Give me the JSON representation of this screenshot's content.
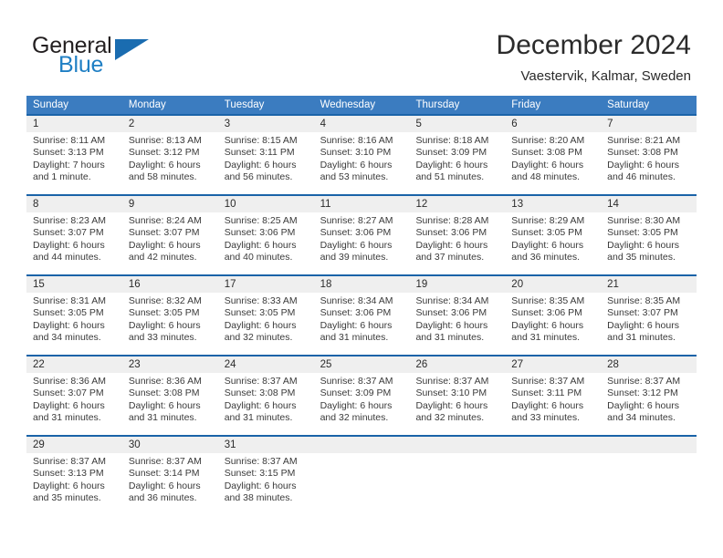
{
  "brand": {
    "word_one": "General",
    "word_two": "Blue",
    "triangle_color": "#1a6cb0",
    "blue_text_color": "#1f7fc4"
  },
  "header": {
    "title": "December 2024",
    "location": "Vaestervik, Kalmar, Sweden"
  },
  "theme": {
    "header_row_bg": "#3b7cc0",
    "week_divider": "#1a63a8",
    "date_band_bg": "#efefef"
  },
  "weekday_headers": [
    "Sunday",
    "Monday",
    "Tuesday",
    "Wednesday",
    "Thursday",
    "Friday",
    "Saturday"
  ],
  "weeks": [
    [
      {
        "day": "1",
        "sunrise": "Sunrise: 8:11 AM",
        "sunset": "Sunset: 3:13 PM",
        "daylight_1": "Daylight: 7 hours",
        "daylight_2": "and 1 minute."
      },
      {
        "day": "2",
        "sunrise": "Sunrise: 8:13 AM",
        "sunset": "Sunset: 3:12 PM",
        "daylight_1": "Daylight: 6 hours",
        "daylight_2": "and 58 minutes."
      },
      {
        "day": "3",
        "sunrise": "Sunrise: 8:15 AM",
        "sunset": "Sunset: 3:11 PM",
        "daylight_1": "Daylight: 6 hours",
        "daylight_2": "and 56 minutes."
      },
      {
        "day": "4",
        "sunrise": "Sunrise: 8:16 AM",
        "sunset": "Sunset: 3:10 PM",
        "daylight_1": "Daylight: 6 hours",
        "daylight_2": "and 53 minutes."
      },
      {
        "day": "5",
        "sunrise": "Sunrise: 8:18 AM",
        "sunset": "Sunset: 3:09 PM",
        "daylight_1": "Daylight: 6 hours",
        "daylight_2": "and 51 minutes."
      },
      {
        "day": "6",
        "sunrise": "Sunrise: 8:20 AM",
        "sunset": "Sunset: 3:08 PM",
        "daylight_1": "Daylight: 6 hours",
        "daylight_2": "and 48 minutes."
      },
      {
        "day": "7",
        "sunrise": "Sunrise: 8:21 AM",
        "sunset": "Sunset: 3:08 PM",
        "daylight_1": "Daylight: 6 hours",
        "daylight_2": "and 46 minutes."
      }
    ],
    [
      {
        "day": "8",
        "sunrise": "Sunrise: 8:23 AM",
        "sunset": "Sunset: 3:07 PM",
        "daylight_1": "Daylight: 6 hours",
        "daylight_2": "and 44 minutes."
      },
      {
        "day": "9",
        "sunrise": "Sunrise: 8:24 AM",
        "sunset": "Sunset: 3:07 PM",
        "daylight_1": "Daylight: 6 hours",
        "daylight_2": "and 42 minutes."
      },
      {
        "day": "10",
        "sunrise": "Sunrise: 8:25 AM",
        "sunset": "Sunset: 3:06 PM",
        "daylight_1": "Daylight: 6 hours",
        "daylight_2": "and 40 minutes."
      },
      {
        "day": "11",
        "sunrise": "Sunrise: 8:27 AM",
        "sunset": "Sunset: 3:06 PM",
        "daylight_1": "Daylight: 6 hours",
        "daylight_2": "and 39 minutes."
      },
      {
        "day": "12",
        "sunrise": "Sunrise: 8:28 AM",
        "sunset": "Sunset: 3:06 PM",
        "daylight_1": "Daylight: 6 hours",
        "daylight_2": "and 37 minutes."
      },
      {
        "day": "13",
        "sunrise": "Sunrise: 8:29 AM",
        "sunset": "Sunset: 3:05 PM",
        "daylight_1": "Daylight: 6 hours",
        "daylight_2": "and 36 minutes."
      },
      {
        "day": "14",
        "sunrise": "Sunrise: 8:30 AM",
        "sunset": "Sunset: 3:05 PM",
        "daylight_1": "Daylight: 6 hours",
        "daylight_2": "and 35 minutes."
      }
    ],
    [
      {
        "day": "15",
        "sunrise": "Sunrise: 8:31 AM",
        "sunset": "Sunset: 3:05 PM",
        "daylight_1": "Daylight: 6 hours",
        "daylight_2": "and 34 minutes."
      },
      {
        "day": "16",
        "sunrise": "Sunrise: 8:32 AM",
        "sunset": "Sunset: 3:05 PM",
        "daylight_1": "Daylight: 6 hours",
        "daylight_2": "and 33 minutes."
      },
      {
        "day": "17",
        "sunrise": "Sunrise: 8:33 AM",
        "sunset": "Sunset: 3:05 PM",
        "daylight_1": "Daylight: 6 hours",
        "daylight_2": "and 32 minutes."
      },
      {
        "day": "18",
        "sunrise": "Sunrise: 8:34 AM",
        "sunset": "Sunset: 3:06 PM",
        "daylight_1": "Daylight: 6 hours",
        "daylight_2": "and 31 minutes."
      },
      {
        "day": "19",
        "sunrise": "Sunrise: 8:34 AM",
        "sunset": "Sunset: 3:06 PM",
        "daylight_1": "Daylight: 6 hours",
        "daylight_2": "and 31 minutes."
      },
      {
        "day": "20",
        "sunrise": "Sunrise: 8:35 AM",
        "sunset": "Sunset: 3:06 PM",
        "daylight_1": "Daylight: 6 hours",
        "daylight_2": "and 31 minutes."
      },
      {
        "day": "21",
        "sunrise": "Sunrise: 8:35 AM",
        "sunset": "Sunset: 3:07 PM",
        "daylight_1": "Daylight: 6 hours",
        "daylight_2": "and 31 minutes."
      }
    ],
    [
      {
        "day": "22",
        "sunrise": "Sunrise: 8:36 AM",
        "sunset": "Sunset: 3:07 PM",
        "daylight_1": "Daylight: 6 hours",
        "daylight_2": "and 31 minutes."
      },
      {
        "day": "23",
        "sunrise": "Sunrise: 8:36 AM",
        "sunset": "Sunset: 3:08 PM",
        "daylight_1": "Daylight: 6 hours",
        "daylight_2": "and 31 minutes."
      },
      {
        "day": "24",
        "sunrise": "Sunrise: 8:37 AM",
        "sunset": "Sunset: 3:08 PM",
        "daylight_1": "Daylight: 6 hours",
        "daylight_2": "and 31 minutes."
      },
      {
        "day": "25",
        "sunrise": "Sunrise: 8:37 AM",
        "sunset": "Sunset: 3:09 PM",
        "daylight_1": "Daylight: 6 hours",
        "daylight_2": "and 32 minutes."
      },
      {
        "day": "26",
        "sunrise": "Sunrise: 8:37 AM",
        "sunset": "Sunset: 3:10 PM",
        "daylight_1": "Daylight: 6 hours",
        "daylight_2": "and 32 minutes."
      },
      {
        "day": "27",
        "sunrise": "Sunrise: 8:37 AM",
        "sunset": "Sunset: 3:11 PM",
        "daylight_1": "Daylight: 6 hours",
        "daylight_2": "and 33 minutes."
      },
      {
        "day": "28",
        "sunrise": "Sunrise: 8:37 AM",
        "sunset": "Sunset: 3:12 PM",
        "daylight_1": "Daylight: 6 hours",
        "daylight_2": "and 34 minutes."
      }
    ],
    [
      {
        "day": "29",
        "sunrise": "Sunrise: 8:37 AM",
        "sunset": "Sunset: 3:13 PM",
        "daylight_1": "Daylight: 6 hours",
        "daylight_2": "and 35 minutes."
      },
      {
        "day": "30",
        "sunrise": "Sunrise: 8:37 AM",
        "sunset": "Sunset: 3:14 PM",
        "daylight_1": "Daylight: 6 hours",
        "daylight_2": "and 36 minutes."
      },
      {
        "day": "31",
        "sunrise": "Sunrise: 8:37 AM",
        "sunset": "Sunset: 3:15 PM",
        "daylight_1": "Daylight: 6 hours",
        "daylight_2": "and 38 minutes."
      },
      {
        "day": "",
        "sunrise": "",
        "sunset": "",
        "daylight_1": "",
        "daylight_2": ""
      },
      {
        "day": "",
        "sunrise": "",
        "sunset": "",
        "daylight_1": "",
        "daylight_2": ""
      },
      {
        "day": "",
        "sunrise": "",
        "sunset": "",
        "daylight_1": "",
        "daylight_2": ""
      },
      {
        "day": "",
        "sunrise": "",
        "sunset": "",
        "daylight_1": "",
        "daylight_2": ""
      }
    ]
  ]
}
